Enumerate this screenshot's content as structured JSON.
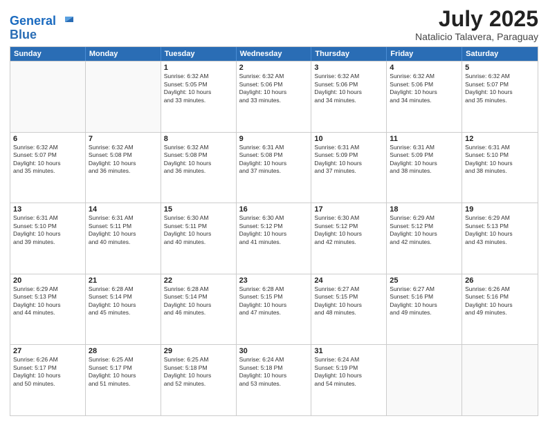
{
  "header": {
    "logo_line1": "General",
    "logo_line2": "Blue",
    "month_year": "July 2025",
    "location": "Natalicio Talavera, Paraguay"
  },
  "days_of_week": [
    "Sunday",
    "Monday",
    "Tuesday",
    "Wednesday",
    "Thursday",
    "Friday",
    "Saturday"
  ],
  "weeks": [
    [
      {
        "day": "",
        "lines": []
      },
      {
        "day": "",
        "lines": []
      },
      {
        "day": "1",
        "lines": [
          "Sunrise: 6:32 AM",
          "Sunset: 5:05 PM",
          "Daylight: 10 hours",
          "and 33 minutes."
        ]
      },
      {
        "day": "2",
        "lines": [
          "Sunrise: 6:32 AM",
          "Sunset: 5:06 PM",
          "Daylight: 10 hours",
          "and 33 minutes."
        ]
      },
      {
        "day": "3",
        "lines": [
          "Sunrise: 6:32 AM",
          "Sunset: 5:06 PM",
          "Daylight: 10 hours",
          "and 34 minutes."
        ]
      },
      {
        "day": "4",
        "lines": [
          "Sunrise: 6:32 AM",
          "Sunset: 5:06 PM",
          "Daylight: 10 hours",
          "and 34 minutes."
        ]
      },
      {
        "day": "5",
        "lines": [
          "Sunrise: 6:32 AM",
          "Sunset: 5:07 PM",
          "Daylight: 10 hours",
          "and 35 minutes."
        ]
      }
    ],
    [
      {
        "day": "6",
        "lines": [
          "Sunrise: 6:32 AM",
          "Sunset: 5:07 PM",
          "Daylight: 10 hours",
          "and 35 minutes."
        ]
      },
      {
        "day": "7",
        "lines": [
          "Sunrise: 6:32 AM",
          "Sunset: 5:08 PM",
          "Daylight: 10 hours",
          "and 36 minutes."
        ]
      },
      {
        "day": "8",
        "lines": [
          "Sunrise: 6:32 AM",
          "Sunset: 5:08 PM",
          "Daylight: 10 hours",
          "and 36 minutes."
        ]
      },
      {
        "day": "9",
        "lines": [
          "Sunrise: 6:31 AM",
          "Sunset: 5:08 PM",
          "Daylight: 10 hours",
          "and 37 minutes."
        ]
      },
      {
        "day": "10",
        "lines": [
          "Sunrise: 6:31 AM",
          "Sunset: 5:09 PM",
          "Daylight: 10 hours",
          "and 37 minutes."
        ]
      },
      {
        "day": "11",
        "lines": [
          "Sunrise: 6:31 AM",
          "Sunset: 5:09 PM",
          "Daylight: 10 hours",
          "and 38 minutes."
        ]
      },
      {
        "day": "12",
        "lines": [
          "Sunrise: 6:31 AM",
          "Sunset: 5:10 PM",
          "Daylight: 10 hours",
          "and 38 minutes."
        ]
      }
    ],
    [
      {
        "day": "13",
        "lines": [
          "Sunrise: 6:31 AM",
          "Sunset: 5:10 PM",
          "Daylight: 10 hours",
          "and 39 minutes."
        ]
      },
      {
        "day": "14",
        "lines": [
          "Sunrise: 6:31 AM",
          "Sunset: 5:11 PM",
          "Daylight: 10 hours",
          "and 40 minutes."
        ]
      },
      {
        "day": "15",
        "lines": [
          "Sunrise: 6:30 AM",
          "Sunset: 5:11 PM",
          "Daylight: 10 hours",
          "and 40 minutes."
        ]
      },
      {
        "day": "16",
        "lines": [
          "Sunrise: 6:30 AM",
          "Sunset: 5:12 PM",
          "Daylight: 10 hours",
          "and 41 minutes."
        ]
      },
      {
        "day": "17",
        "lines": [
          "Sunrise: 6:30 AM",
          "Sunset: 5:12 PM",
          "Daylight: 10 hours",
          "and 42 minutes."
        ]
      },
      {
        "day": "18",
        "lines": [
          "Sunrise: 6:29 AM",
          "Sunset: 5:12 PM",
          "Daylight: 10 hours",
          "and 42 minutes."
        ]
      },
      {
        "day": "19",
        "lines": [
          "Sunrise: 6:29 AM",
          "Sunset: 5:13 PM",
          "Daylight: 10 hours",
          "and 43 minutes."
        ]
      }
    ],
    [
      {
        "day": "20",
        "lines": [
          "Sunrise: 6:29 AM",
          "Sunset: 5:13 PM",
          "Daylight: 10 hours",
          "and 44 minutes."
        ]
      },
      {
        "day": "21",
        "lines": [
          "Sunrise: 6:28 AM",
          "Sunset: 5:14 PM",
          "Daylight: 10 hours",
          "and 45 minutes."
        ]
      },
      {
        "day": "22",
        "lines": [
          "Sunrise: 6:28 AM",
          "Sunset: 5:14 PM",
          "Daylight: 10 hours",
          "and 46 minutes."
        ]
      },
      {
        "day": "23",
        "lines": [
          "Sunrise: 6:28 AM",
          "Sunset: 5:15 PM",
          "Daylight: 10 hours",
          "and 47 minutes."
        ]
      },
      {
        "day": "24",
        "lines": [
          "Sunrise: 6:27 AM",
          "Sunset: 5:15 PM",
          "Daylight: 10 hours",
          "and 48 minutes."
        ]
      },
      {
        "day": "25",
        "lines": [
          "Sunrise: 6:27 AM",
          "Sunset: 5:16 PM",
          "Daylight: 10 hours",
          "and 49 minutes."
        ]
      },
      {
        "day": "26",
        "lines": [
          "Sunrise: 6:26 AM",
          "Sunset: 5:16 PM",
          "Daylight: 10 hours",
          "and 49 minutes."
        ]
      }
    ],
    [
      {
        "day": "27",
        "lines": [
          "Sunrise: 6:26 AM",
          "Sunset: 5:17 PM",
          "Daylight: 10 hours",
          "and 50 minutes."
        ]
      },
      {
        "day": "28",
        "lines": [
          "Sunrise: 6:25 AM",
          "Sunset: 5:17 PM",
          "Daylight: 10 hours",
          "and 51 minutes."
        ]
      },
      {
        "day": "29",
        "lines": [
          "Sunrise: 6:25 AM",
          "Sunset: 5:18 PM",
          "Daylight: 10 hours",
          "and 52 minutes."
        ]
      },
      {
        "day": "30",
        "lines": [
          "Sunrise: 6:24 AM",
          "Sunset: 5:18 PM",
          "Daylight: 10 hours",
          "and 53 minutes."
        ]
      },
      {
        "day": "31",
        "lines": [
          "Sunrise: 6:24 AM",
          "Sunset: 5:19 PM",
          "Daylight: 10 hours",
          "and 54 minutes."
        ]
      },
      {
        "day": "",
        "lines": []
      },
      {
        "day": "",
        "lines": []
      }
    ]
  ]
}
